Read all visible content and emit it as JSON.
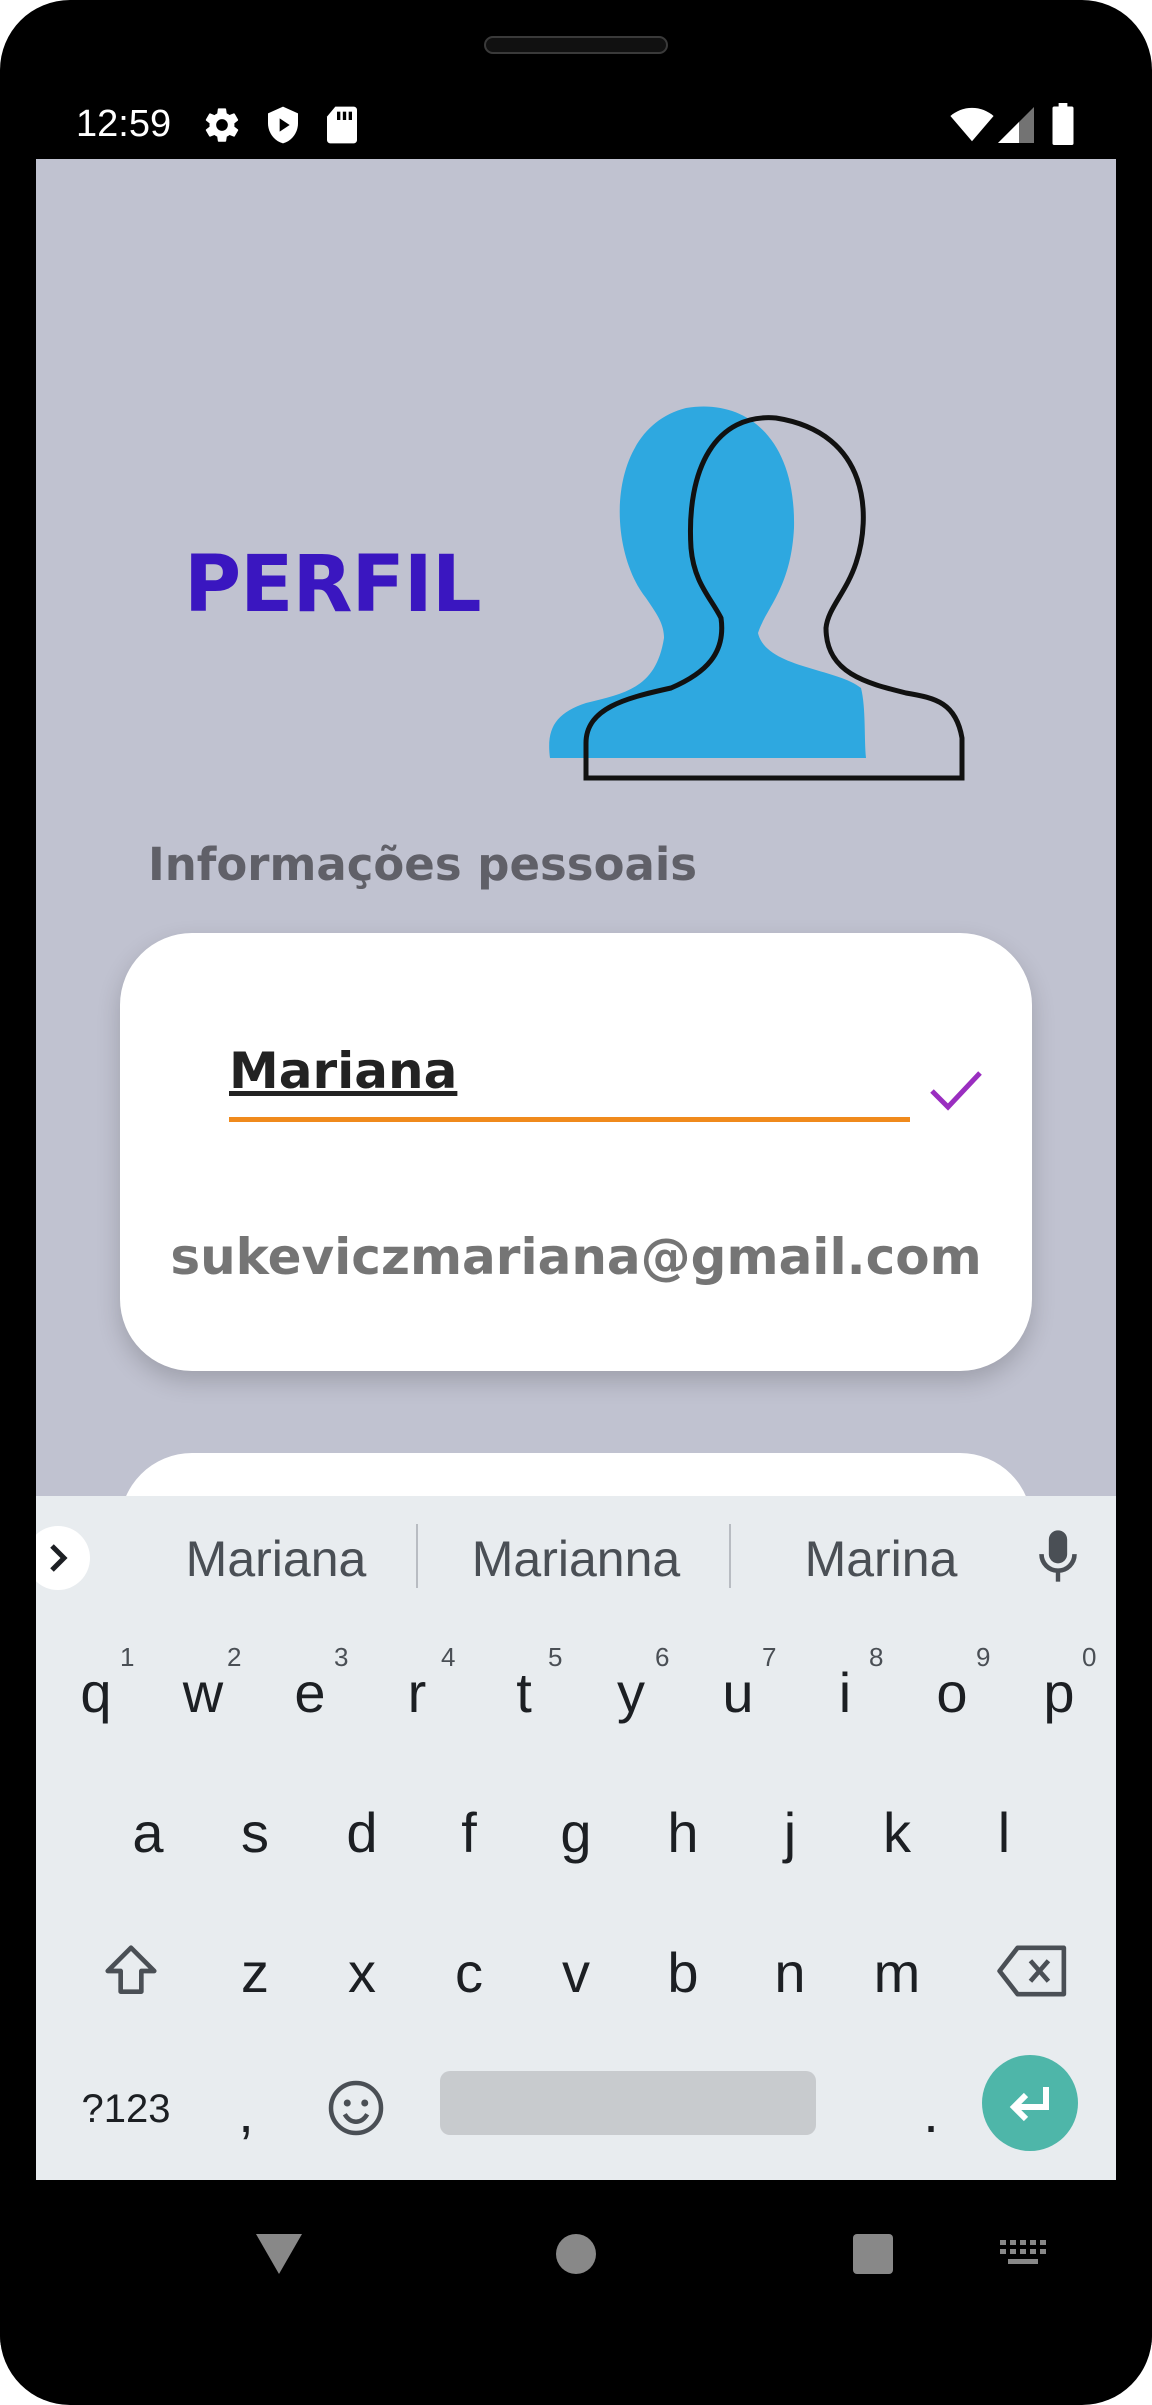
{
  "status_bar": {
    "time": "12:59",
    "left_icons": [
      "gear-icon",
      "shield-play-icon",
      "sd-card-icon"
    ],
    "right_icons": [
      "wifi-icon",
      "signal-icon",
      "battery-icon"
    ]
  },
  "page": {
    "title": "PERFIL",
    "section_label": "Informações pessoais"
  },
  "profile_card": {
    "name_value": "Mariana",
    "email": "sukeviczmariana@gmail.com"
  },
  "keyboard": {
    "suggestions": [
      "Mariana",
      "Marianna",
      "Marina"
    ],
    "row1": [
      "q",
      "w",
      "e",
      "r",
      "t",
      "y",
      "u",
      "i",
      "o",
      "p"
    ],
    "row1_hints": [
      "1",
      "2",
      "3",
      "4",
      "5",
      "6",
      "7",
      "8",
      "9",
      "0"
    ],
    "row2": [
      "a",
      "s",
      "d",
      "f",
      "g",
      "h",
      "j",
      "k",
      "l"
    ],
    "row3": [
      "z",
      "x",
      "c",
      "v",
      "b",
      "n",
      "m"
    ],
    "symbols_label": "?123",
    "comma": ",",
    "period": "."
  },
  "colors": {
    "title": "#3a16c0",
    "accent_underline": "#f08a1c",
    "check": "#9a2ec0",
    "avatar": "#2ea8e0",
    "enter_key": "#4eb6a9",
    "background": "#c0c2d0"
  }
}
